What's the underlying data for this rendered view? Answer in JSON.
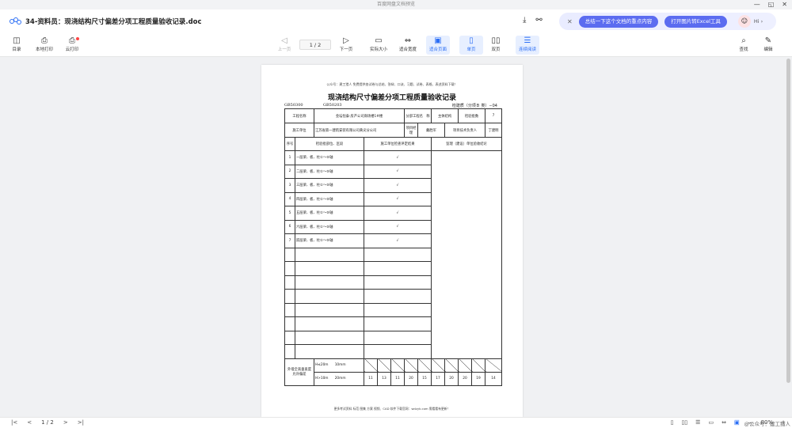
{
  "window": {
    "title": "百度网盘文档预览",
    "controls": [
      "—",
      "◱",
      "✕"
    ]
  },
  "docbar": {
    "filename": "34-资料员：现浇结构尺寸偏差分项工程质量验收记录.doc",
    "download_icon": "download-icon",
    "share_icon": "share-icon"
  },
  "ai": {
    "close": "✕",
    "summary_btn": "总结一下这个文档的重点内容",
    "excel_btn": "打开图片转Excel工具",
    "greeting": "Hi ›"
  },
  "toolbar": {
    "catalog": "目录",
    "local_print": "本地打印",
    "cloud_print": "云打印",
    "prev_page": "上一页",
    "page_indicator": "1 / 2",
    "next_page": "下一页",
    "actual_size": "实际大小",
    "fit_width": "适合宽度",
    "fit_page": "适合页面",
    "single_page": "单页",
    "double_page": "双页",
    "continuous": "连续阅读",
    "find": "查找",
    "edit": "编辑"
  },
  "document": {
    "top_note": "公众号：建工猎人 免费提供各试卷与总结、答辩、口诀、习题、试卷、表格、表述资料下载！",
    "title": "现浇结构尺寸偏差分项工程质量验收记录",
    "gb1": "GB50300",
    "gb2": "GB50203",
    "form_code": "检建质（分项Ｂ 类）−04",
    "rows_info": {
      "project_name_label": "工程名称",
      "project_name": "金坛恒泰·房产公司商场楼1#楼",
      "subdivision_label": "分部工程名　称",
      "subdivision": "主体结构",
      "batch_label": "检验批数",
      "batch_count": "7",
      "constructor_label": "施工单位",
      "constructor": "江苏省第一建筑安装有限公司黄尖分公司",
      "pm_label": "项目经理",
      "pm": "戴胜军",
      "tech_label": "项目技术负责人",
      "tech": "丁建明"
    },
    "headers": {
      "seq": "序号",
      "location": "检验批部位、区段",
      "result": "施工单位检查评定结果",
      "supervision": "监理（建设）单位验收结论"
    },
    "items": [
      {
        "no": "1",
        "loc": "一层梁、板、柱①～⑩轴",
        "mark": "√"
      },
      {
        "no": "2",
        "loc": "二层梁、板、柱①～⑩轴",
        "mark": "√"
      },
      {
        "no": "3",
        "loc": "三层梁、板、柱①～⑩轴",
        "mark": "√"
      },
      {
        "no": "4",
        "loc": "四层梁、板、柱①～⑩轴",
        "mark": "√"
      },
      {
        "no": "5",
        "loc": "五层梁、板、柱①～⑩轴",
        "mark": "√"
      },
      {
        "no": "6",
        "loc": "六层梁、板、柱①～⑩轴",
        "mark": "√"
      },
      {
        "no": "7",
        "loc": "跃层梁、板、柱①～⑩轴",
        "mark": "√"
      }
    ],
    "bottom": {
      "label": "外墙全高垂直度允许偏差",
      "h1": "H≤20m",
      "v1": "10mm",
      "h2": "H>10m",
      "v2": "20mm",
      "measured": [
        "11",
        "13",
        "11",
        "20",
        "15",
        "17",
        "20",
        "20",
        "19",
        "14"
      ]
    },
    "footer": "更多考试资料 标范 图集 方案 视频、CAD 软件下载官网：wdzyk.com 需看看有更新！"
  },
  "status": {
    "page_indicator": "1 / 2",
    "zoom": "80%",
    "watermark": "@公众号：建工猎人"
  }
}
